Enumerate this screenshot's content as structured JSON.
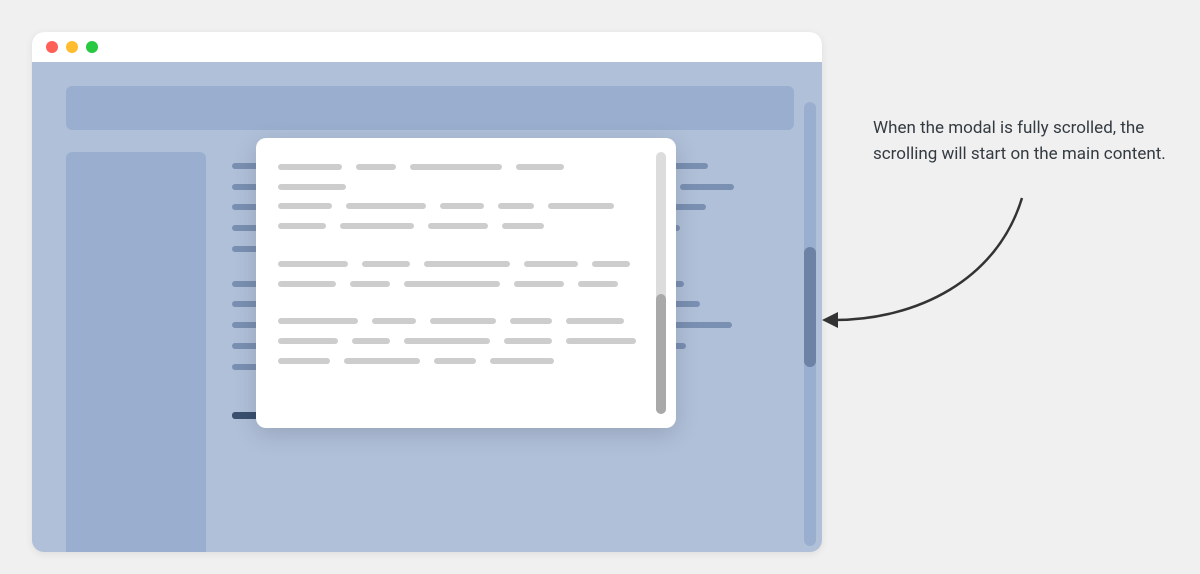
{
  "annotation": {
    "text": "When the modal is fully scrolled, the scrolling will start on the main content."
  },
  "colors": {
    "window_bg": "#b0c0d9",
    "block": "#9aafcf",
    "bg_line": "#7a90b2",
    "bg_heavy": "#3a506e",
    "modal_line": "#cdcdcd",
    "modal_track": "#dcdcdc",
    "modal_thumb": "#a9a9a9",
    "page_thumb": "#6d82a4"
  }
}
